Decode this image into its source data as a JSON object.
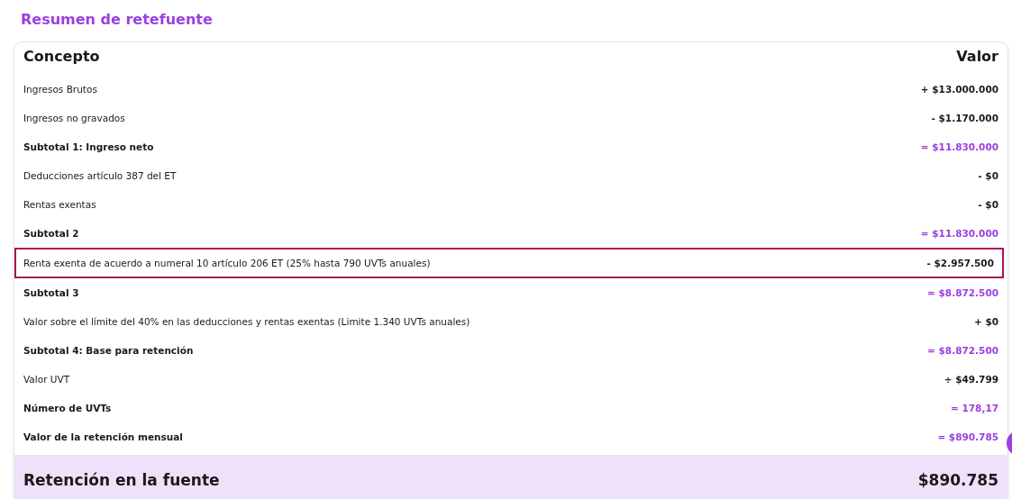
{
  "title": "Resumen de retefuente",
  "table": {
    "columns": [
      "Concepto",
      "Valor"
    ],
    "rows": [
      {
        "kind": "item",
        "label": "Ingresos Brutos",
        "value": "+ $13.000.000",
        "highlighted": false
      },
      {
        "kind": "item",
        "label": "Ingresos no gravados",
        "value": "- $1.170.000",
        "highlighted": false
      },
      {
        "kind": "subtotal",
        "label": "Subtotal 1: Ingreso neto",
        "value": "= $11.830.000",
        "highlighted": false
      },
      {
        "kind": "item",
        "label": "Deducciones artículo 387 del ET",
        "value": "- $0",
        "highlighted": false
      },
      {
        "kind": "item",
        "label": "Rentas exentas",
        "value": "- $0",
        "highlighted": false
      },
      {
        "kind": "subtotal",
        "label": "Subtotal 2",
        "value": "= $11.830.000",
        "highlighted": false
      },
      {
        "kind": "item",
        "label": "Renta exenta de acuerdo a numeral 10 artículo 206 ET (25% hasta 790 UVTs anuales)",
        "value": "- $2.957.500",
        "highlighted": true
      },
      {
        "kind": "subtotal",
        "label": "Subtotal 3",
        "value": "= $8.872.500",
        "highlighted": false
      },
      {
        "kind": "item",
        "label": "Valor sobre el límite del 40% en las deducciones y rentas exentas (Limite 1.340 UVTs anuales)",
        "value": "+ $0",
        "highlighted": false
      },
      {
        "kind": "subtotal",
        "label": "Subtotal 4: Base para retención",
        "value": "= $8.872.500",
        "highlighted": false
      },
      {
        "kind": "item",
        "label": "Valor UVT",
        "value": "÷ $49.799",
        "highlighted": false
      },
      {
        "kind": "subtotal",
        "label": "Número de UVTs",
        "value": "= 178,17",
        "highlighted": false
      },
      {
        "kind": "subtotal",
        "label": "Valor de la retención mensual",
        "value": "= $890.785",
        "highlighted": false
      }
    ]
  },
  "total": {
    "label": "Retención en la fuente",
    "value": "$890.785"
  }
}
